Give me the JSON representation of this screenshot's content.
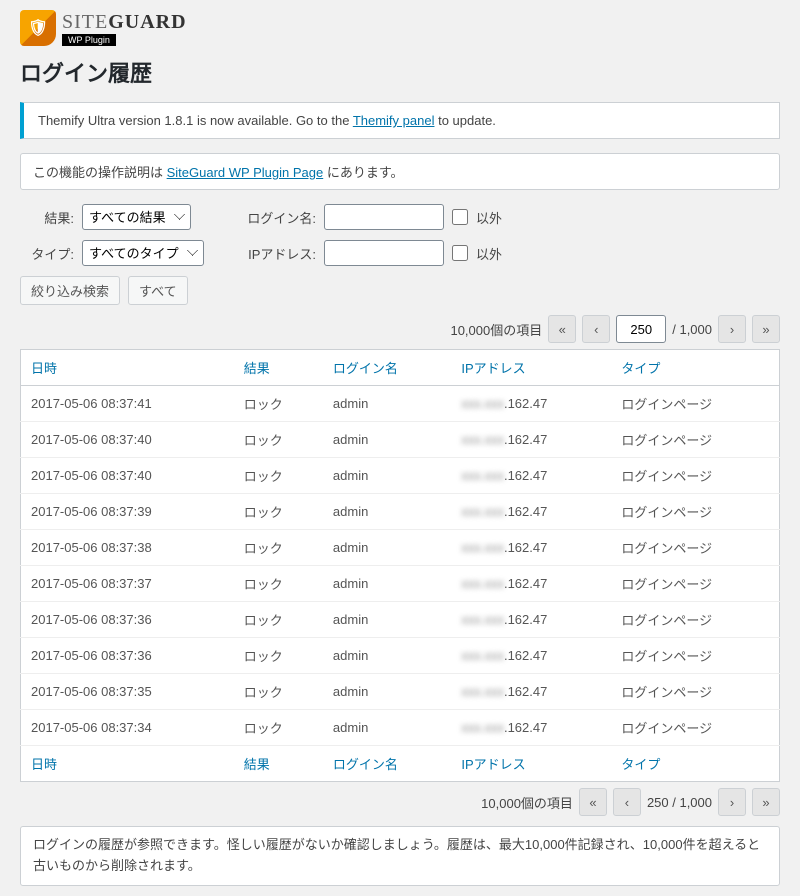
{
  "logo": {
    "brand_light": "SITE",
    "brand_bold": "GUARD",
    "sub": "WP Plugin"
  },
  "page_title": "ログイン履歴",
  "update_notice": {
    "pre": "Themify Ultra version 1.8.1 is now available. Go to the ",
    "link": "Themify panel",
    "post": " to update."
  },
  "info": {
    "pre": "この機能の操作説明は ",
    "link": "SiteGuard WP Plugin Page",
    "post": " にあります。"
  },
  "filters": {
    "result_label": "結果:",
    "result_option": "すべての結果",
    "type_label": "タイプ:",
    "type_option": "すべてのタイプ",
    "login_label": "ログイン名:",
    "ip_label": "IPアドレス:",
    "except_label": "以外",
    "search_btn": "絞り込み検索",
    "all_btn": "すべて"
  },
  "pagination": {
    "total_items": "10,000個の項目",
    "first": "«",
    "prev": "‹",
    "page_value": "250",
    "total_pages": "/ 1,000",
    "page_text_compact": "250 / 1,000",
    "next": "›",
    "last": "»"
  },
  "columns": {
    "datetime": "日時",
    "result": "結果",
    "login": "ログイン名",
    "ip": "IPアドレス",
    "type": "タイプ"
  },
  "rows": [
    {
      "datetime": "2017-05-06 08:37:41",
      "result": "ロック",
      "login": "admin",
      "ip_hidden": "xxx.xxx",
      "ip_shown": ".162.47",
      "type": "ログインページ"
    },
    {
      "datetime": "2017-05-06 08:37:40",
      "result": "ロック",
      "login": "admin",
      "ip_hidden": "xxx.xxx",
      "ip_shown": ".162.47",
      "type": "ログインページ"
    },
    {
      "datetime": "2017-05-06 08:37:40",
      "result": "ロック",
      "login": "admin",
      "ip_hidden": "xxx.xxx",
      "ip_shown": ".162.47",
      "type": "ログインページ"
    },
    {
      "datetime": "2017-05-06 08:37:39",
      "result": "ロック",
      "login": "admin",
      "ip_hidden": "xxx.xxx",
      "ip_shown": ".162.47",
      "type": "ログインページ"
    },
    {
      "datetime": "2017-05-06 08:37:38",
      "result": "ロック",
      "login": "admin",
      "ip_hidden": "xxx.xxx",
      "ip_shown": ".162.47",
      "type": "ログインページ"
    },
    {
      "datetime": "2017-05-06 08:37:37",
      "result": "ロック",
      "login": "admin",
      "ip_hidden": "xxx.xxx",
      "ip_shown": ".162.47",
      "type": "ログインページ"
    },
    {
      "datetime": "2017-05-06 08:37:36",
      "result": "ロック",
      "login": "admin",
      "ip_hidden": "xxx.xxx",
      "ip_shown": ".162.47",
      "type": "ログインページ"
    },
    {
      "datetime": "2017-05-06 08:37:36",
      "result": "ロック",
      "login": "admin",
      "ip_hidden": "xxx.xxx",
      "ip_shown": ".162.47",
      "type": "ログインページ"
    },
    {
      "datetime": "2017-05-06 08:37:35",
      "result": "ロック",
      "login": "admin",
      "ip_hidden": "xxx.xxx",
      "ip_shown": ".162.47",
      "type": "ログインページ"
    },
    {
      "datetime": "2017-05-06 08:37:34",
      "result": "ロック",
      "login": "admin",
      "ip_hidden": "xxx.xxx",
      "ip_shown": ".162.47",
      "type": "ログインページ"
    }
  ],
  "description": "ログインの履歴が参照できます。怪しい履歴がないか確認しましょう。履歴は、最大10,000件記録され、10,000件を超えると古いものから削除されます。"
}
